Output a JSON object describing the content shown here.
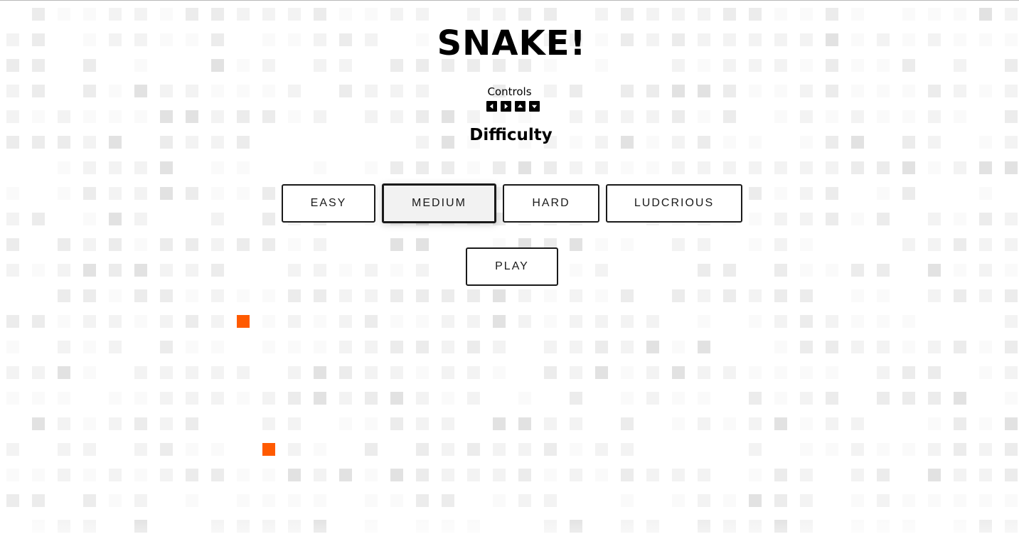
{
  "game": {
    "title": "SNAKE!",
    "controls_label": "Controls",
    "control_keys": [
      {
        "name": "left-arrow-key-icon",
        "direction": "left"
      },
      {
        "name": "right-arrow-key-icon",
        "direction": "right"
      },
      {
        "name": "up-arrow-key-icon",
        "direction": "up"
      },
      {
        "name": "down-arrow-key-icon",
        "direction": "down"
      }
    ],
    "difficulty_heading": "Difficulty",
    "difficulty_options": [
      "EASY",
      "MEDIUM",
      "HARD",
      "LUDCRIOUS"
    ],
    "selected_difficulty": "MEDIUM",
    "play_label": "PLAY"
  },
  "board": {
    "columns": 40,
    "rows": 21,
    "food_cells": [
      [
        9,
        12
      ],
      [
        10,
        17
      ]
    ],
    "colors": {
      "food": "#ff5a00",
      "background": "#ffffff",
      "tile_shades": [
        "#fafafa",
        "#f3f3f3",
        "#ececec",
        "#e2e2e2"
      ]
    }
  }
}
